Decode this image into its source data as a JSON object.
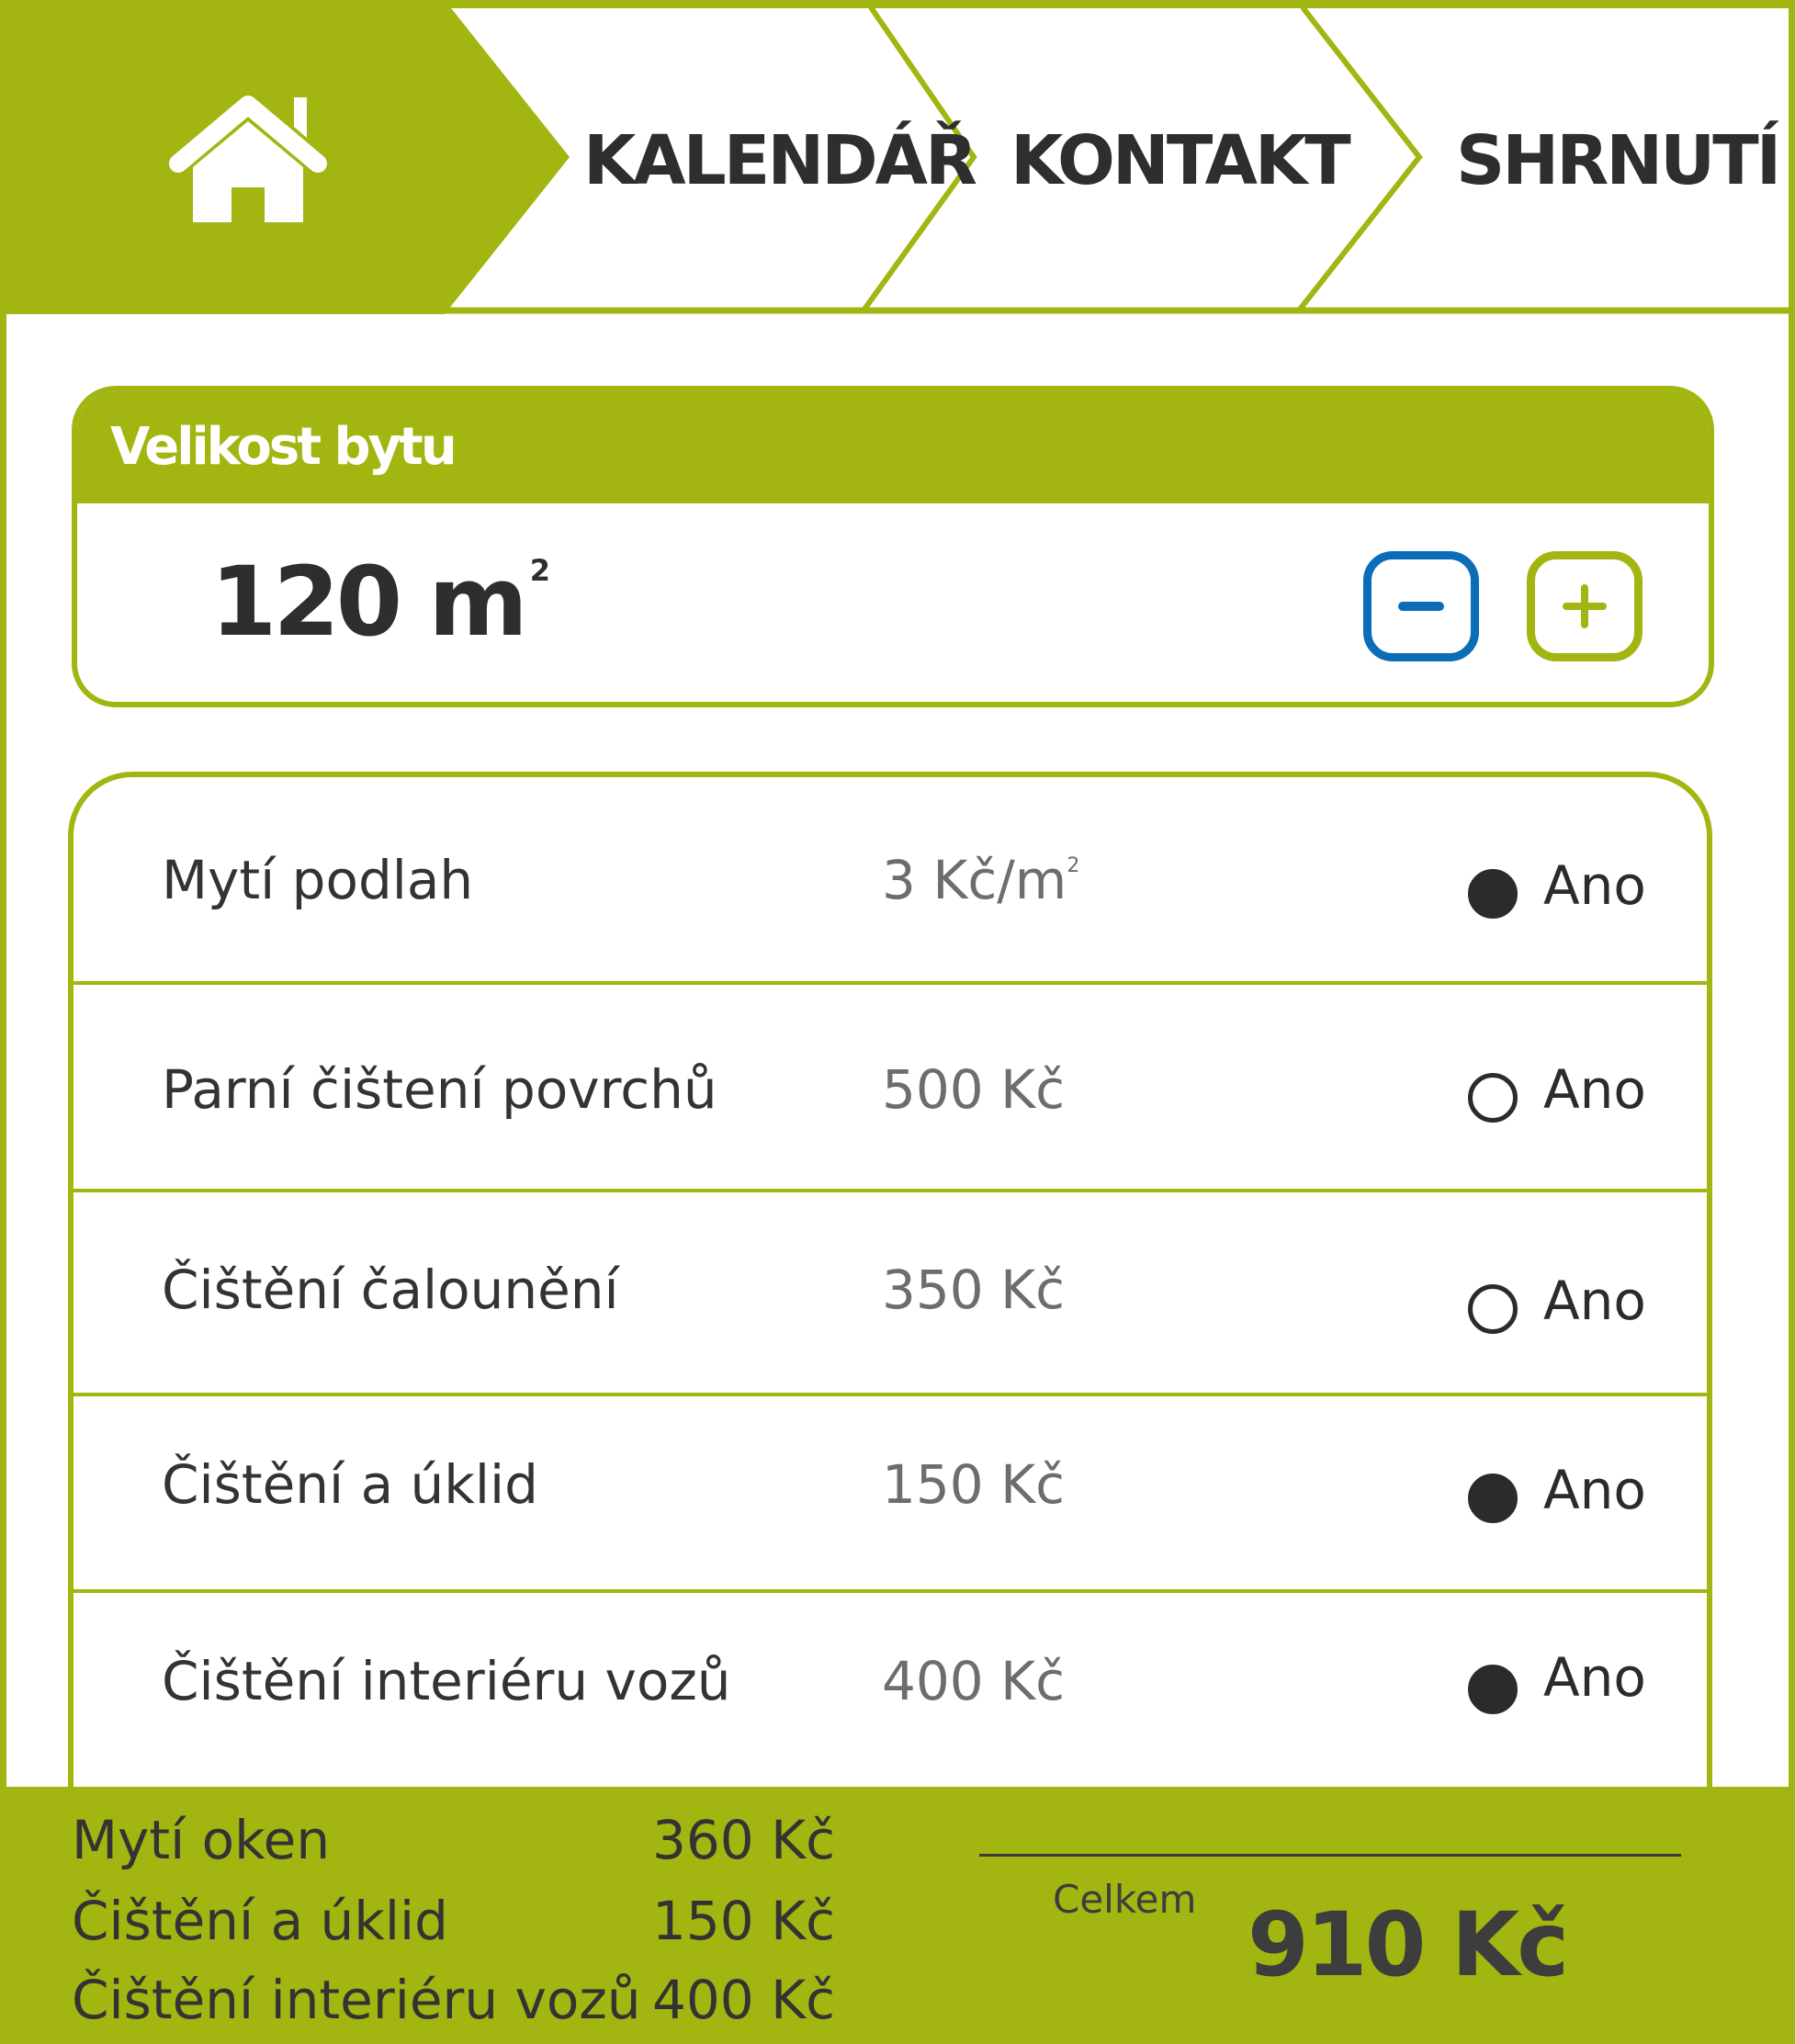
{
  "colors": {
    "accent": "#a2b510",
    "minus_button": "#0b6cb8",
    "text_dark": "#333333",
    "price_gray": "#6d6d6d"
  },
  "nav": {
    "home_icon": "home-icon",
    "steps": [
      {
        "label": "KALENDÁŘ"
      },
      {
        "label": "KONTAKT"
      },
      {
        "label": "SHRNUTÍ"
      }
    ]
  },
  "apartment_size": {
    "title": "Velikost bytu",
    "value": "120",
    "unit": "m",
    "unit_superscript": "2",
    "decrease_icon": "minus-icon",
    "increase_icon": "plus-icon"
  },
  "services": [
    {
      "name": "Mytí podlah",
      "price": "3 Kč/m",
      "price_superscript": "2",
      "selected": true,
      "option_label": "Ano"
    },
    {
      "name": "Parní čištení povrchů",
      "price": "500 Kč",
      "price_superscript": "",
      "selected": false,
      "option_label": "Ano"
    },
    {
      "name": "Čištění čalounění",
      "price": "350 Kč",
      "price_superscript": "",
      "selected": false,
      "option_label": "Ano"
    },
    {
      "name": "Čištění a úklid",
      "price": "150 Kč",
      "price_superscript": "",
      "selected": true,
      "option_label": "Ano"
    },
    {
      "name": "Čištění interiéru vozů",
      "price": "400 Kč",
      "price_superscript": "",
      "selected": true,
      "option_label": "Ano"
    }
  ],
  "summary": {
    "items": [
      {
        "name": "Mytí oken",
        "price": "360 Kč"
      },
      {
        "name": "Čištění a úklid",
        "price": "150 Kč"
      },
      {
        "name": "Čištění interiéru vozů",
        "price": "400 Kč"
      }
    ],
    "total_label": "Celkem",
    "total_value": "910 Kč"
  }
}
